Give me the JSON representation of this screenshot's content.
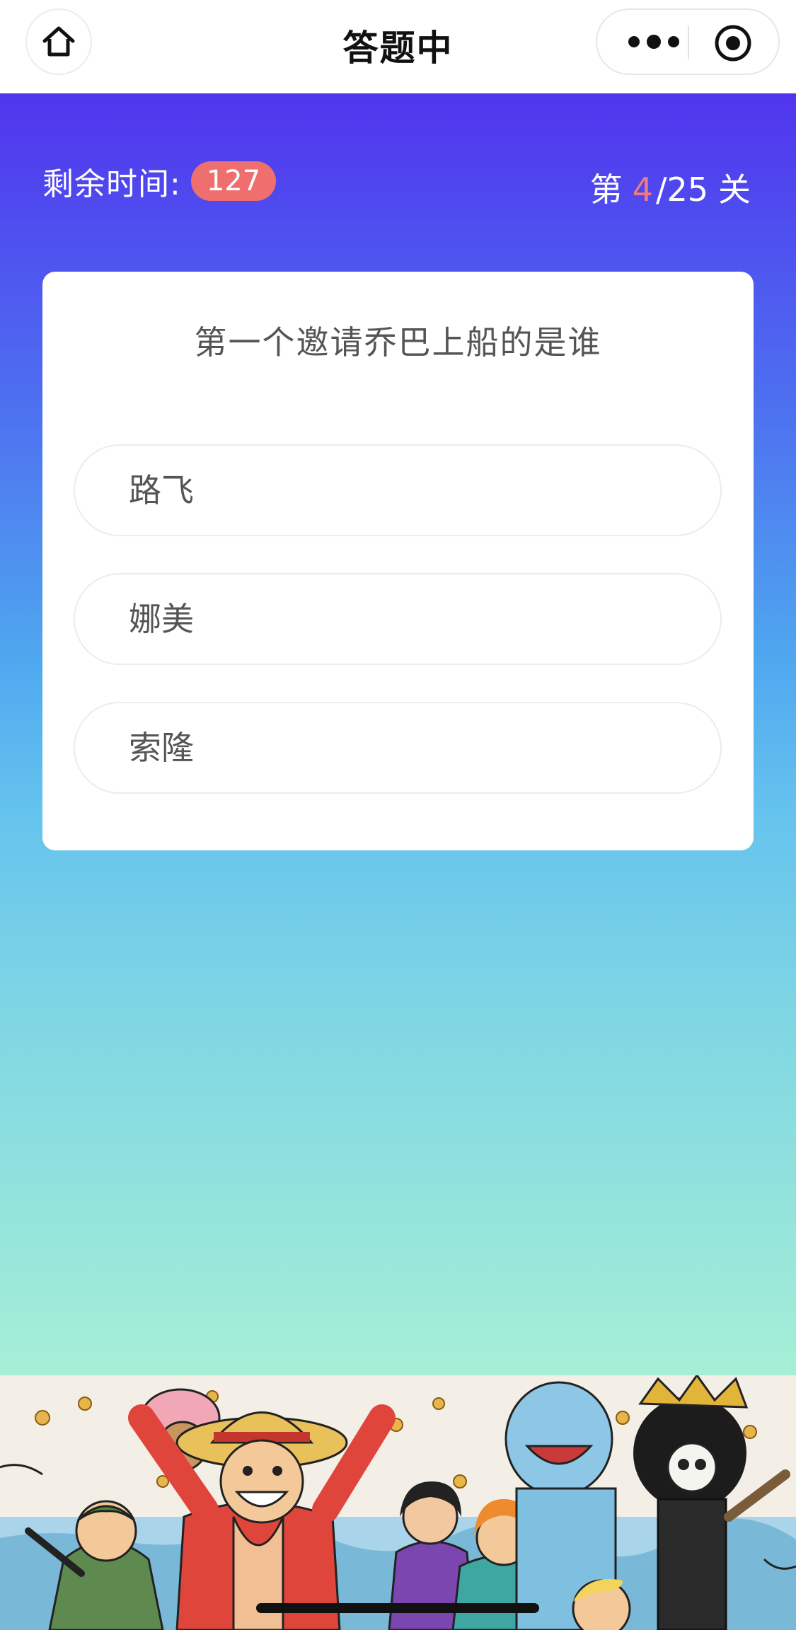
{
  "navbar": {
    "title": "答题中",
    "home_icon": "home-icon",
    "more_icon": "more-dots-icon",
    "close_icon": "target-circle-icon"
  },
  "status": {
    "timer_label": "剩余时间:",
    "timer_value": "127",
    "level_prefix": "第",
    "level_current": "4",
    "level_total": "/25",
    "level_suffix": "关"
  },
  "quiz": {
    "question": "第一个邀请乔巴上船的是谁",
    "options": [
      "路飞",
      "娜美",
      "索隆"
    ]
  },
  "colors": {
    "gradient_top": "#5035ee",
    "gradient_bottom": "#a6efd6",
    "timer_badge": "#ee6f6e",
    "level_current": "#f07b7e"
  }
}
